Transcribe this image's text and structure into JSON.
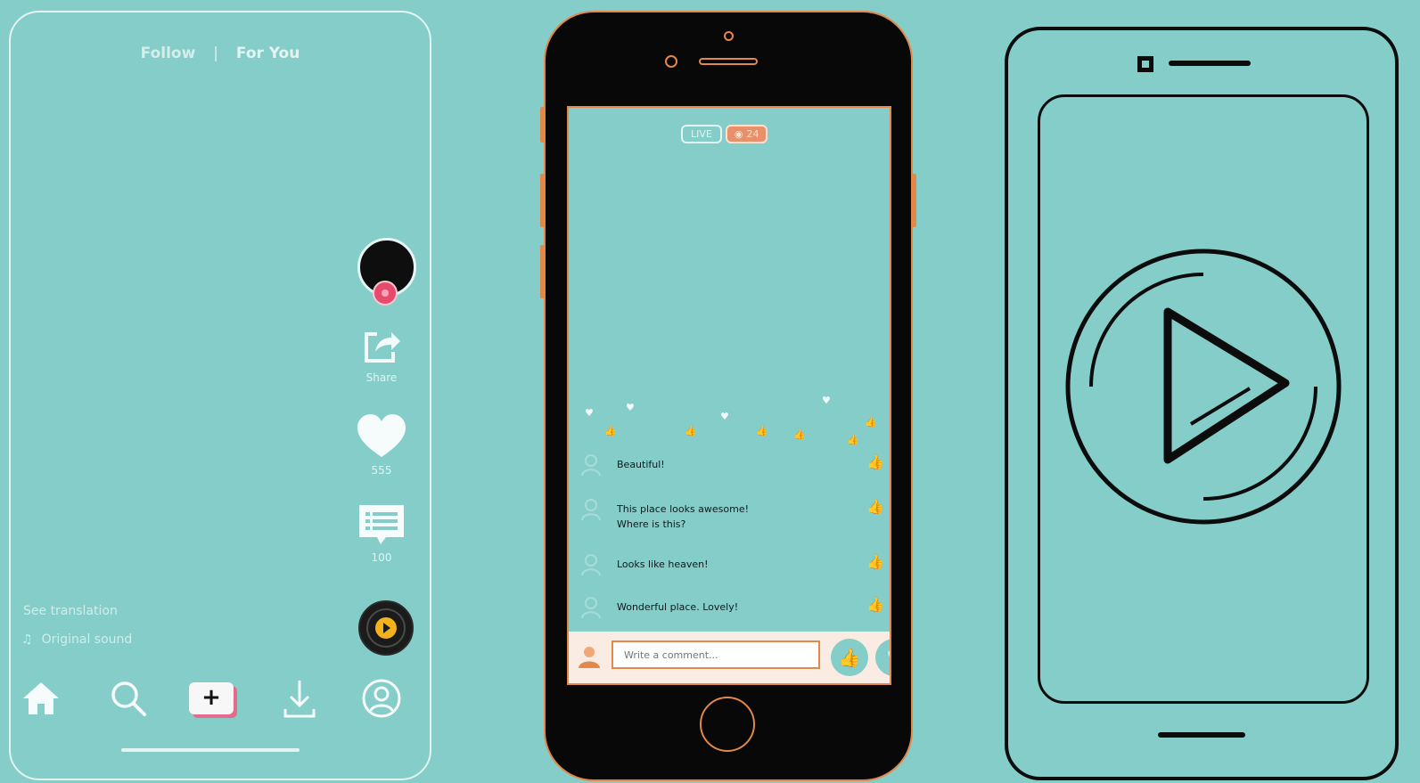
{
  "colors": {
    "background": "#85cdc9",
    "accent_orange": "#e2884a",
    "accent_pink": "#e64b6e",
    "outline_dark": "#0c0c0c"
  },
  "feed_phone": {
    "tabs": {
      "follow": "Follow",
      "separator": "|",
      "for_you": "For You"
    },
    "actions": {
      "share_label": "Share",
      "likes_count": "555",
      "comments_count": "100"
    },
    "see_translation": "See translation",
    "original_sound": "Original sound",
    "nav_icons": [
      "home-icon",
      "search-icon",
      "create-icon",
      "download-icon",
      "profile-icon"
    ]
  },
  "live_phone": {
    "live_label": "LIVE",
    "viewer_count": "24",
    "comments": [
      {
        "text": "Beautiful!"
      },
      {
        "text": "This place looks awesome! Where is this?"
      },
      {
        "text": "Looks like heaven!"
      },
      {
        "text": "Wonderful place. Lovely!"
      }
    ],
    "comment_placeholder": "Write a comment..."
  },
  "player_phone": {
    "icon": "play-icon"
  }
}
